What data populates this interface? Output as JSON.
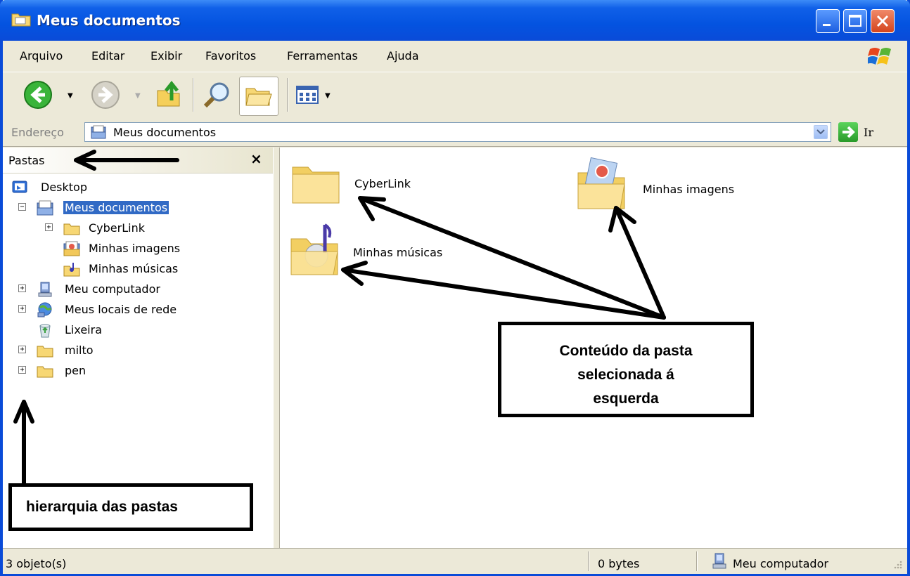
{
  "window": {
    "title": "Meus documentos"
  },
  "menu": [
    "Arquivo",
    "Editar",
    "Exibir",
    "Favoritos",
    "Ferramentas",
    "Ajuda"
  ],
  "address": {
    "label": "Endereço",
    "value": "Meus documentos",
    "go_label": "Ir"
  },
  "folders_pane": {
    "title": "Pastas",
    "tree": [
      {
        "label": "Desktop",
        "icon": "desktop-icon",
        "level": 0,
        "expander": ""
      },
      {
        "label": "Meus documentos",
        "icon": "my-documents-icon",
        "level": 1,
        "expander": "−",
        "selected": true
      },
      {
        "label": "CyberLink",
        "icon": "folder-icon",
        "level": 2,
        "expander": "+"
      },
      {
        "label": "Minhas imagens",
        "icon": "my-pictures-icon",
        "level": 2,
        "expander": ""
      },
      {
        "label": "Minhas músicas",
        "icon": "my-music-icon",
        "level": 2,
        "expander": ""
      },
      {
        "label": "Meu computador",
        "icon": "my-computer-icon",
        "level": 1,
        "expander": "+"
      },
      {
        "label": "Meus locais de rede",
        "icon": "network-places-icon",
        "level": 1,
        "expander": "+"
      },
      {
        "label": "Lixeira",
        "icon": "recycle-bin-icon",
        "level": 1,
        "expander": ""
      },
      {
        "label": "milto",
        "icon": "folder-icon",
        "level": 1,
        "expander": "+"
      },
      {
        "label": "pen",
        "icon": "folder-icon",
        "level": 1,
        "expander": "+"
      }
    ]
  },
  "content": [
    {
      "label": "CyberLink",
      "icon": "folder-icon"
    },
    {
      "label": "Minhas imagens",
      "icon": "my-pictures-folder-icon"
    },
    {
      "label": "Minhas músicas",
      "icon": "my-music-folder-icon"
    }
  ],
  "annotations": {
    "content_callout": [
      "Conteúdo da pasta",
      "selecionada á",
      "esquerda"
    ],
    "hierarchy_callout": "hierarquia das pastas"
  },
  "status": {
    "objects": "3 objeto(s)",
    "size": "0 bytes",
    "location": "Meu computador"
  },
  "colors": {
    "titlebar": "#0a4bd8",
    "selection": "#316ac5",
    "chrome": "#ece9d8"
  }
}
